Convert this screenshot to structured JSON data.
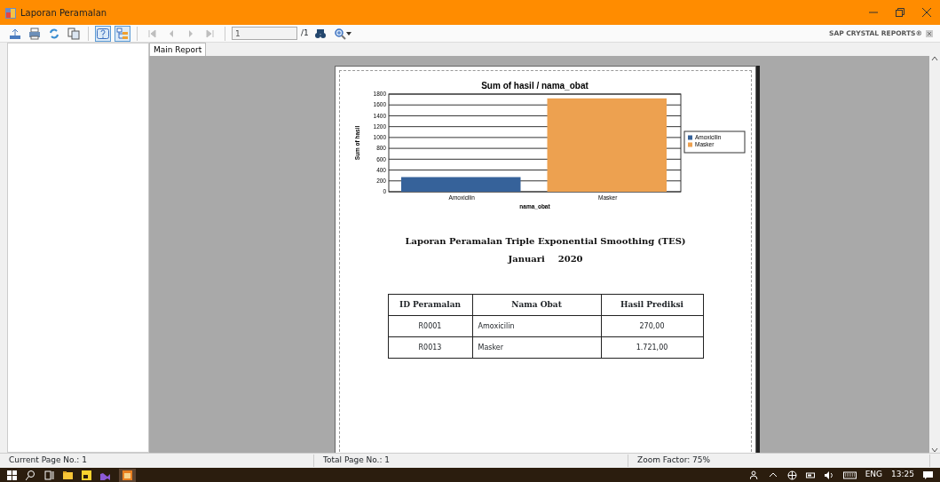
{
  "window": {
    "title": "Laporan Peramalan"
  },
  "toolbar": {
    "help_pressed": true,
    "group_tree_pressed": true,
    "navigation_disabled": true,
    "page_field": {
      "value": "1"
    },
    "page_total": "/1",
    "brand": "SAP CRYSTAL REPORTS®"
  },
  "tabs": [
    {
      "label": "Main Report",
      "selected": true
    }
  ],
  "report": {
    "chart_data": {
      "type": "bar",
      "title": "Sum of hasil / nama_obat",
      "xlabel": "nama_obat",
      "ylabel": "Sum of hasil",
      "categories": [
        "Amoxicilin",
        "Masker"
      ],
      "series": [
        {
          "name": "Amoxicilin",
          "color": "#36629a",
          "values": [
            270,
            null
          ]
        },
        {
          "name": "Masker",
          "color": "#eda150",
          "values": [
            null,
            1721
          ]
        }
      ],
      "ylim": [
        0,
        1800
      ],
      "yticks": [
        0,
        200,
        400,
        600,
        800,
        1000,
        1200,
        1400,
        1600,
        1800
      ],
      "grid": true,
      "legend": true
    },
    "heading": "Laporan Peramalan Triple Exponential Smoothing (TES)",
    "period": [
      "Januari",
      "2020"
    ],
    "table": {
      "columns": [
        "ID Peramalan",
        "Nama Obat",
        "Hasil Prediksi"
      ],
      "rows": [
        [
          "R0001",
          "Amoxicilin",
          "270,00"
        ],
        [
          "R0013",
          "Masker",
          "1.721,00"
        ]
      ]
    }
  },
  "status_bar": [
    "Current Page No.: 1",
    "Total Page No.: 1",
    "Zoom Factor: 75%"
  ],
  "taskbar": {
    "tray": [
      "ENG",
      "13:25"
    ]
  }
}
